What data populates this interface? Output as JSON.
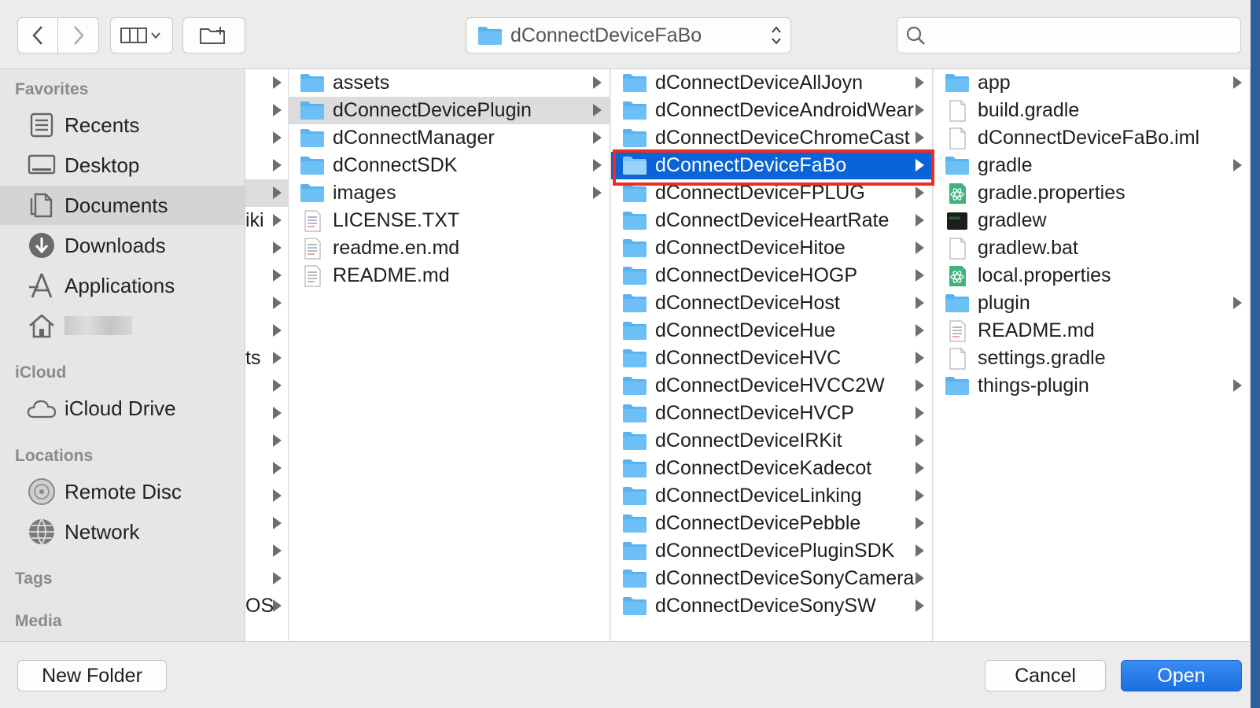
{
  "toolbar": {
    "back_icon": "chevron-left-icon",
    "forward_icon": "chevron-right-icon",
    "view_icon": "column-view-icon",
    "new_folder_icon": "new-folder-icon",
    "path_label": "dConnectDeviceFaBo",
    "search_value": "",
    "search_placeholder": ""
  },
  "sidebar": {
    "sections": {
      "favorites": "Favorites",
      "icloud": "iCloud",
      "locations": "Locations",
      "tags": "Tags",
      "media": "Media"
    },
    "items": [
      {
        "label": "Recents",
        "icon": "recents-icon"
      },
      {
        "label": "Desktop",
        "icon": "desktop-icon"
      },
      {
        "label": "Documents",
        "icon": "documents-icon",
        "selected": true
      },
      {
        "label": "Downloads",
        "icon": "downloads-icon"
      },
      {
        "label": "Applications",
        "icon": "applications-icon"
      },
      {
        "label": "",
        "icon": "home-icon"
      },
      {
        "label": "iCloud Drive",
        "icon": "cloud-icon"
      },
      {
        "label": "Remote Disc",
        "icon": "disc-icon"
      },
      {
        "label": "Network",
        "icon": "network-icon"
      }
    ]
  },
  "column0": {
    "fragments": [
      "iki",
      "ts",
      "OS"
    ]
  },
  "column1": {
    "items": [
      {
        "name": "assets",
        "type": "folder"
      },
      {
        "name": "dConnectDevicePlugin",
        "type": "folder"
      },
      {
        "name": "dConnectManager",
        "type": "folder"
      },
      {
        "name": "dConnectSDK",
        "type": "folder"
      },
      {
        "name": "images",
        "type": "folder"
      },
      {
        "name": "LICENSE.TXT",
        "type": "text"
      },
      {
        "name": "readme.en.md",
        "type": "md"
      },
      {
        "name": "README.md",
        "type": "md"
      }
    ]
  },
  "column2": {
    "items": [
      {
        "name": "dConnectDeviceAllJoyn"
      },
      {
        "name": "dConnectDeviceAndroidWear"
      },
      {
        "name": "dConnectDeviceChromeCast"
      },
      {
        "name": "dConnectDeviceFaBo"
      },
      {
        "name": "dConnectDeviceFPLUG"
      },
      {
        "name": "dConnectDeviceHeartRate"
      },
      {
        "name": "dConnectDeviceHitoe"
      },
      {
        "name": "dConnectDeviceHOGP"
      },
      {
        "name": "dConnectDeviceHost"
      },
      {
        "name": "dConnectDeviceHue"
      },
      {
        "name": "dConnectDeviceHVC"
      },
      {
        "name": "dConnectDeviceHVCC2W"
      },
      {
        "name": "dConnectDeviceHVCP"
      },
      {
        "name": "dConnectDeviceIRKit"
      },
      {
        "name": "dConnectDeviceKadecot"
      },
      {
        "name": "dConnectDeviceLinking"
      },
      {
        "name": "dConnectDevicePebble"
      },
      {
        "name": "dConnectDevicePluginSDK"
      },
      {
        "name": "dConnectDeviceSonyCamera"
      },
      {
        "name": "dConnectDeviceSonySW"
      }
    ]
  },
  "column3": {
    "items": [
      {
        "name": "app",
        "type": "folder"
      },
      {
        "name": "build.gradle",
        "type": "blank"
      },
      {
        "name": "dConnectDeviceFaBo.iml",
        "type": "blank"
      },
      {
        "name": "gradle",
        "type": "folder"
      },
      {
        "name": "gradle.properties",
        "type": "atom"
      },
      {
        "name": "gradlew",
        "type": "exec"
      },
      {
        "name": "gradlew.bat",
        "type": "blank"
      },
      {
        "name": "local.properties",
        "type": "atom"
      },
      {
        "name": "plugin",
        "type": "folder"
      },
      {
        "name": "README.md",
        "type": "md"
      },
      {
        "name": "settings.gradle",
        "type": "blank"
      },
      {
        "name": "things-plugin",
        "type": "folder"
      }
    ]
  },
  "buttons": {
    "new_folder": "New Folder",
    "cancel": "Cancel",
    "open": "Open"
  },
  "colors": {
    "selection": "#0a63d8",
    "highlight_frame": "#f02b1d",
    "folder": "#5ab2ef"
  }
}
